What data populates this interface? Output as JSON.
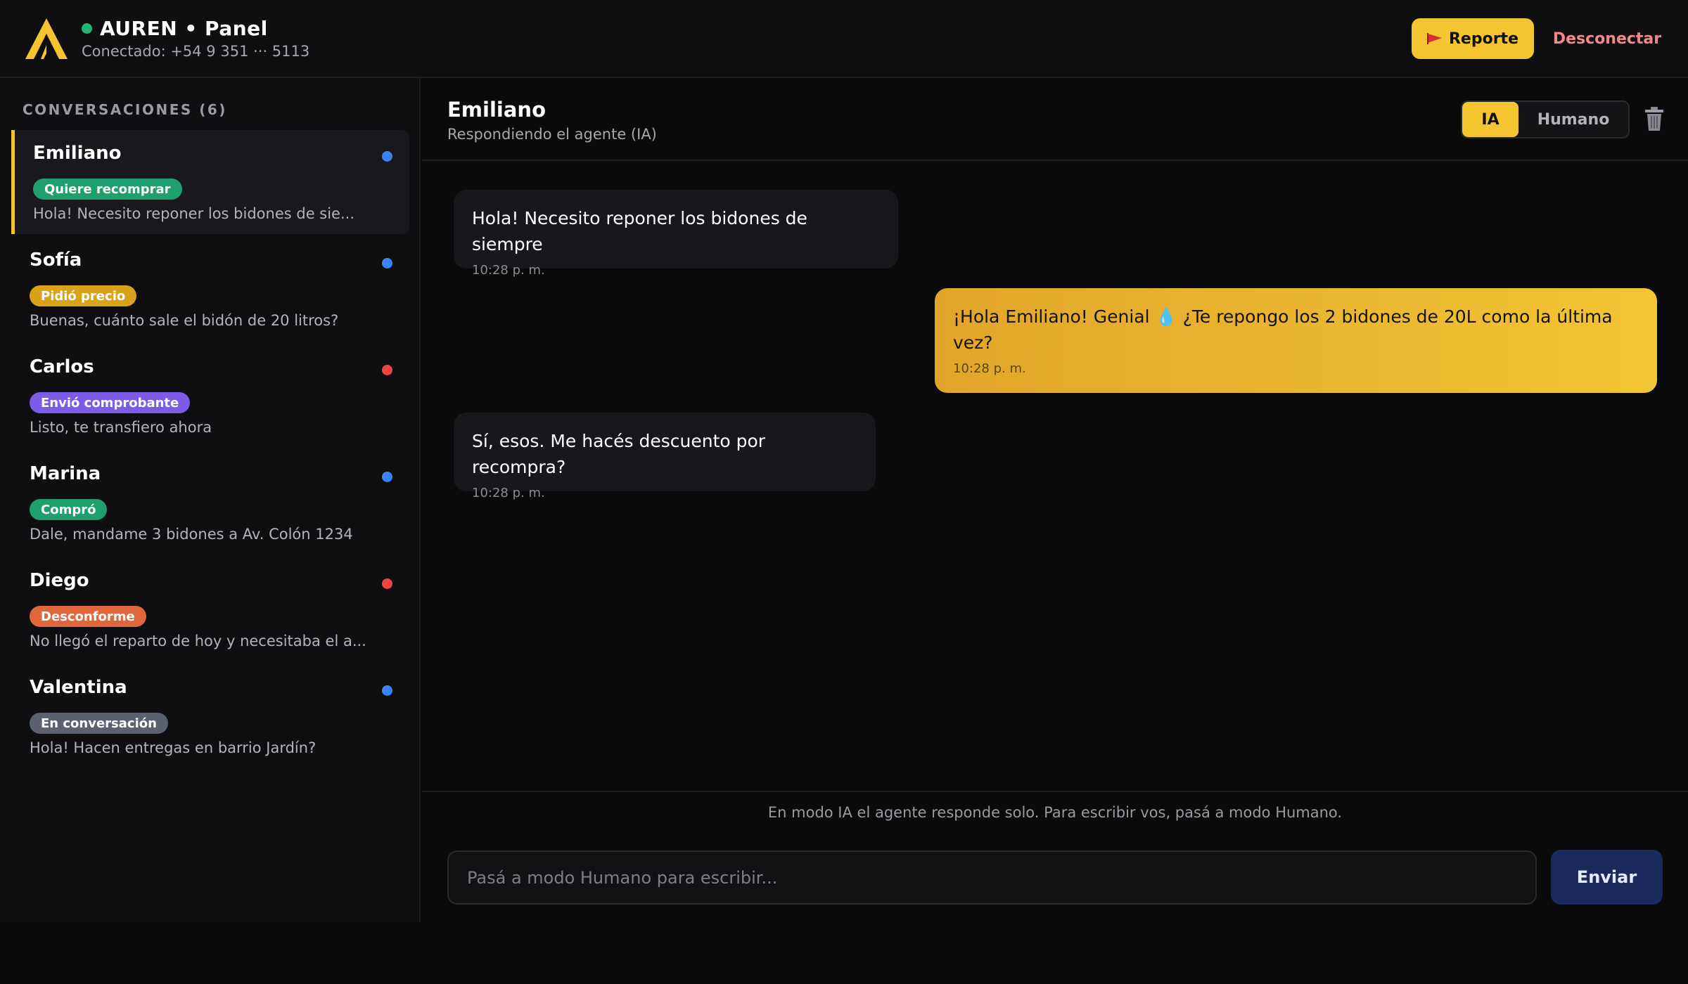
{
  "header": {
    "title": "AUREN • Panel",
    "connection": "Conectado: +54 9 351 ··· 5113",
    "report_label": "Reporte",
    "logout_label": "Desconectar"
  },
  "sidebar": {
    "heading": "CONVERSACIONES (6)",
    "conversations": [
      {
        "name": "Emiliano",
        "tag": "Quiere recomprar",
        "tag_color": "#1f9e6e",
        "preview": "Hola! Necesito reponer los bidones de sie...",
        "dot_color": "#3b82f6",
        "active": true
      },
      {
        "name": "Sofía",
        "tag": "Pidió precio",
        "tag_color": "#d9a21b",
        "preview": "Buenas, cuánto sale el bidón de 20 litros?",
        "dot_color": "#3b82f6"
      },
      {
        "name": "Carlos",
        "tag": "Envió comprobante",
        "tag_color": "#7c5ce6",
        "preview": "Listo, te transfiero ahora",
        "dot_color": "#ef4444"
      },
      {
        "name": "Marina",
        "tag": "Compró",
        "tag_color": "#1f9e6e",
        "preview": "Dale, mandame 3 bidones a Av. Colón 1234",
        "dot_color": "#3b82f6"
      },
      {
        "name": "Diego",
        "tag": "Desconforme",
        "tag_color": "#e0673c",
        "preview": "No llegó el reparto de hoy y necesitaba el a...",
        "dot_color": "#ef4444"
      },
      {
        "name": "Valentina",
        "tag": "En conversación",
        "tag_color": "#5b616e",
        "preview": "Hola! Hacen entregas en barrio Jardín?",
        "dot_color": "#3b82f6"
      }
    ]
  },
  "chat": {
    "contact": "Emiliano",
    "status": "Respondiendo el agente (IA)",
    "mode_ia": "IA",
    "mode_human": "Humano",
    "messages": [
      {
        "direction": "in",
        "text": "Hola! Necesito reponer los bidones de siempre",
        "time": "10:28 p. m."
      },
      {
        "direction": "out",
        "text": "¡Hola Emiliano! Genial 💧 ¿Te repongo los 2 bidones de 20L como la última vez?",
        "time": "10:28 p. m."
      },
      {
        "direction": "in",
        "text": "Sí, esos. Me hacés descuento por recompra?",
        "time": "10:28 p. m."
      }
    ],
    "footer_note": "En modo IA el agente responde solo. Para escribir vos, pasá a modo Humano.",
    "input_placeholder": "Pasá a modo Humano para escribir...",
    "send_label": "Enviar"
  }
}
